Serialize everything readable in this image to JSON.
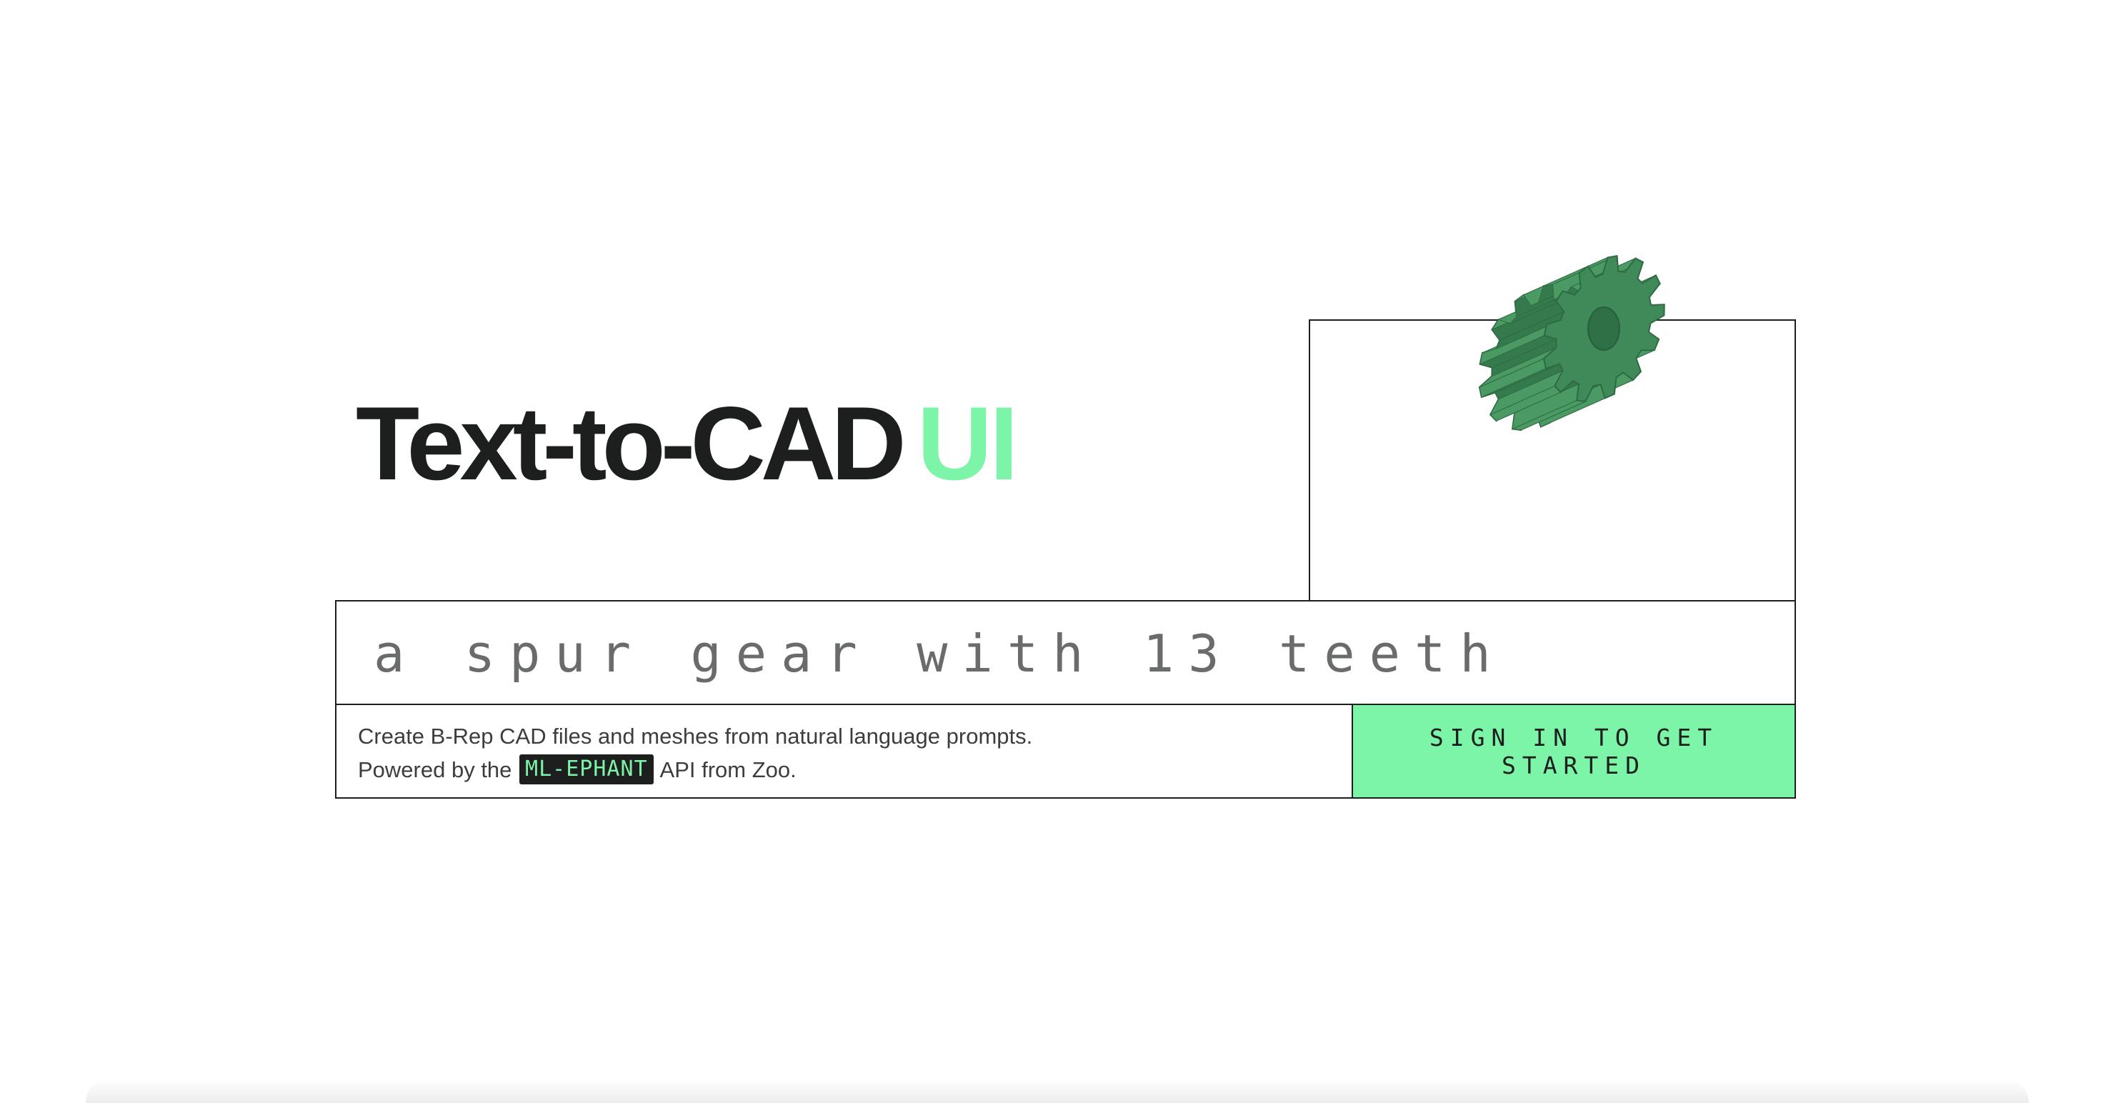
{
  "hero": {
    "title_main": "Text-to-CAD",
    "title_accent": "UI"
  },
  "prompt": {
    "value": "a spur gear with 13 teeth",
    "placeholder": "a spur gear with 13 teeth"
  },
  "description": {
    "line1": "Create B-Rep CAD files and meshes from natural language prompts.",
    "line2_prefix": "Powered by the",
    "badge": "ML-EPHANT",
    "line2_suffix": "API from Zoo."
  },
  "cta": {
    "label": "SIGN IN TO GET STARTED"
  },
  "preview": {
    "icon": "gear-icon"
  },
  "colors": {
    "accent": "#7cf5a9",
    "ink": "#1d1f1e",
    "gear_green": "#3f8a58"
  }
}
